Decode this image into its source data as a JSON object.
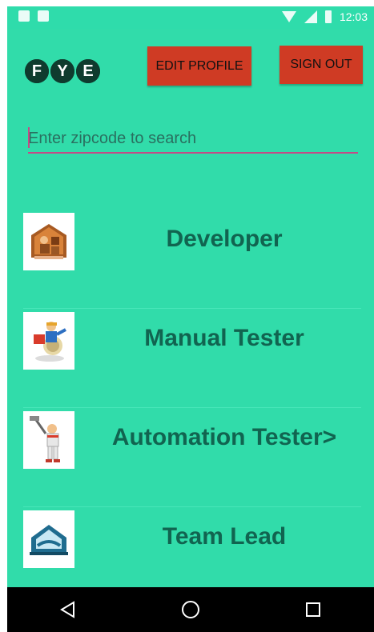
{
  "status_bar": {
    "time": "12:03"
  },
  "logo": {
    "letters": [
      "F",
      "Y",
      "E"
    ]
  },
  "header": {
    "edit_profile_label": "EDIT PROFILE",
    "sign_out_label": "SIGN OUT"
  },
  "search": {
    "placeholder": "Enter zipcode to search",
    "value": ""
  },
  "list": [
    {
      "label": "Developer",
      "icon": "house-construction-icon"
    },
    {
      "label": "Manual Tester",
      "icon": "delivery-worker-icon"
    },
    {
      "label": "Automation Tester>",
      "icon": "painter-icon"
    },
    {
      "label": "Team Lead",
      "icon": "house-logo-icon"
    }
  ],
  "nav_bar": {
    "back": "back-icon",
    "home": "home-icon",
    "recents": "recents-icon"
  },
  "colors": {
    "background": "#31dcaa",
    "button": "#cf3b24",
    "item_text": "#116450",
    "accent": "#c44b86"
  }
}
